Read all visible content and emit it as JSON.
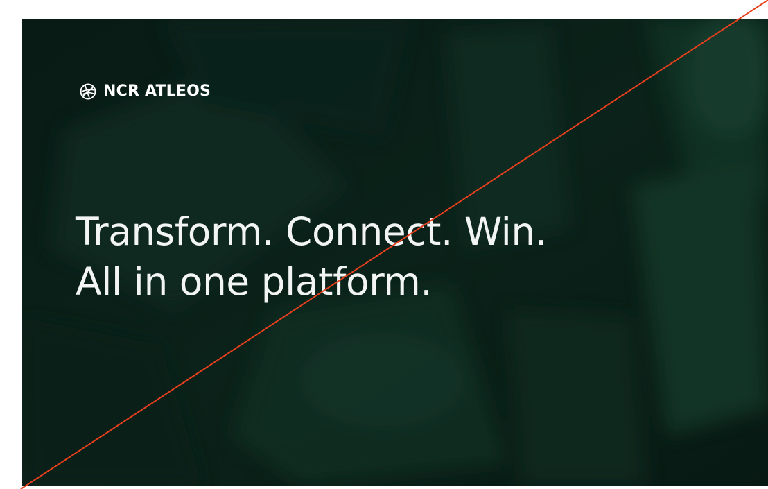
{
  "ad": {
    "brand_name": "NCR ATLEOS",
    "brand_icon": "globe-logo-icon",
    "headline_line1": "Transform. Connect. Win.",
    "headline_line2": "All in one platform."
  },
  "colors": {
    "background": "#0b2219",
    "text": "#ffffff",
    "strike_line": "#e8401c"
  }
}
